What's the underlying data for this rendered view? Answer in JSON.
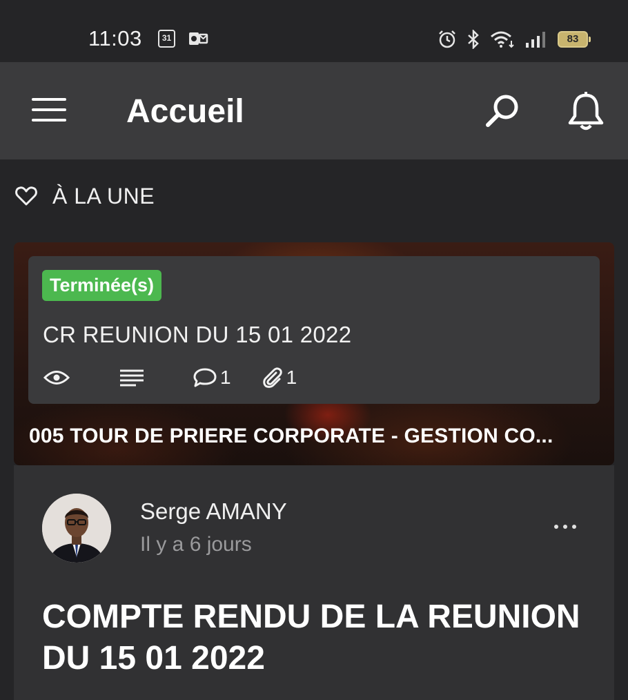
{
  "status_bar": {
    "time": "11:03",
    "calendar_day": "31",
    "battery": "83"
  },
  "app_bar": {
    "title": "Accueil"
  },
  "section": {
    "title": "À LA UNE"
  },
  "featured": {
    "event": {
      "status": "Terminée(s)",
      "status_color": "#4cb84f",
      "title": "CR REUNION DU 15 01 2022",
      "comments": "1",
      "attachments": "1"
    },
    "caption": "005 TOUR DE PRIERE CORPORATE - GESTION CO..."
  },
  "post": {
    "author": "Serge AMANY",
    "time": "Il y a 6 jours",
    "title": "COMPTE RENDU DE LA REUNION DU 15 01 2022"
  }
}
